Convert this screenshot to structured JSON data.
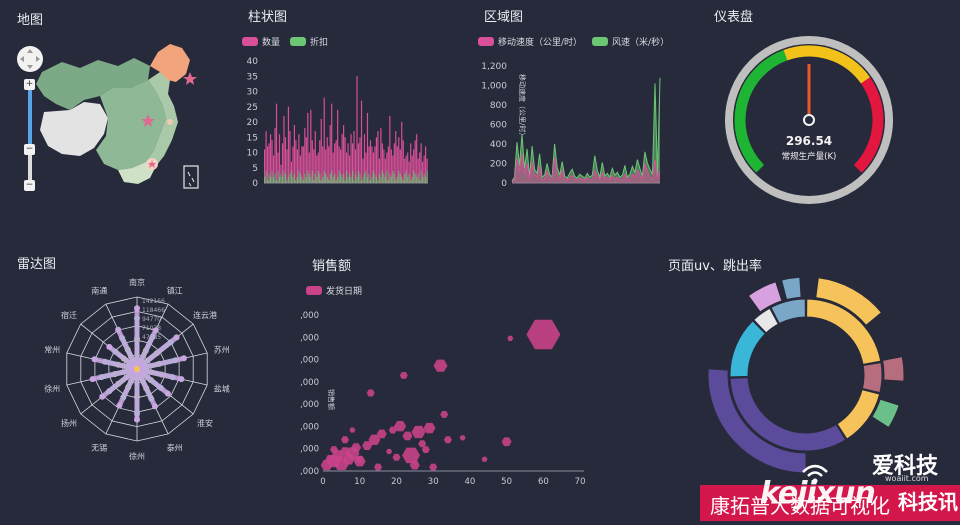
{
  "map": {
    "title": "地图",
    "zoom_in": "+",
    "zoom_out": "−",
    "slider_mid": "−"
  },
  "bar": {
    "title": "柱状图",
    "legend": [
      {
        "name": "数量",
        "color": "#d94f9a"
      },
      {
        "name": "折扣",
        "color": "#6cc775"
      }
    ],
    "yticks": [
      "40",
      "35",
      "30",
      "25",
      "20",
      "15",
      "10",
      "5",
      "0"
    ]
  },
  "area": {
    "title": "区域图",
    "legend": [
      {
        "name": "移动速度（公里/时）",
        "color": "#d94f9a"
      },
      {
        "name": "风速（米/秒）",
        "color": "#6cc775"
      }
    ],
    "yticks": [
      "1,200",
      "1,000",
      "800",
      "600",
      "400",
      "200",
      "0"
    ],
    "ylabel": "移动速度（公里/时）"
  },
  "gauge": {
    "title": "仪表盘",
    "value": "296.54",
    "label": "常规生产量(K)"
  },
  "radar": {
    "title": "雷达图",
    "axes": [
      "南京",
      "镇江",
      "连云港",
      "苏州",
      "盐城",
      "淮安",
      "泰州",
      "徐州",
      "无锡",
      "扬州",
      "徐州",
      "常州",
      "宿迁",
      "南通"
    ],
    "values": [
      "142166",
      "118466",
      "94770",
      "71078",
      "47385"
    ]
  },
  "scatter": {
    "title": "销售额",
    "legend": [
      {
        "name": "发货日期",
        "color": "#c9438a"
      }
    ],
    "yticks": [
      ",000",
      ",000",
      ",000",
      ",000",
      ",000",
      ",000",
      ",000",
      ",000"
    ],
    "xticks": [
      "0",
      "10",
      "20",
      "30",
      "40",
      "50",
      "60",
      "70"
    ],
    "ylabel": "销售额"
  },
  "sunburst": {
    "title": "页面uv、跳出率"
  },
  "watermark": {
    "brand": "爱科技",
    "domain": "woaiit.com",
    "big": "kejixun",
    "big_cn": "科技讯",
    "banner": "康拓普大数据可视化"
  },
  "chart_data": [
    {
      "type": "bar",
      "title": "柱状图",
      "ylim": [
        0,
        40
      ],
      "series": [
        {
          "name": "数量",
          "values": [
            11,
            17,
            12,
            13,
            16,
            14,
            9,
            18,
            26,
            10,
            16,
            6,
            13,
            22,
            15,
            11,
            25,
            17,
            7,
            12,
            19,
            14,
            11,
            16,
            9,
            12,
            12,
            18,
            15,
            23,
            10,
            24,
            14,
            11,
            17,
            9,
            10,
            14,
            21,
            12,
            28,
            11,
            15,
            12,
            19,
            26,
            10,
            13,
            14,
            24,
            12,
            11,
            16,
            19,
            15,
            10,
            13,
            9,
            16,
            13,
            17,
            11,
            35,
            13,
            15,
            27,
            8,
            16,
            10,
            23,
            12,
            14,
            12,
            10,
            12,
            15,
            17,
            8,
            18,
            13,
            11,
            8,
            10,
            12,
            22,
            11,
            9,
            13,
            17,
            12,
            15,
            11,
            20,
            14,
            8,
            9,
            10,
            7,
            13,
            9,
            11,
            14,
            16,
            8,
            10,
            13,
            7,
            9,
            12,
            8
          ]
        },
        {
          "name": "折扣",
          "values": [
            2,
            4,
            1,
            3,
            2,
            4,
            2,
            3,
            1,
            4,
            2,
            3,
            2,
            4,
            3,
            1,
            2,
            3,
            4,
            2,
            3,
            1,
            2,
            4,
            3,
            2,
            1,
            3,
            2,
            4,
            3,
            2,
            4,
            1,
            3,
            2,
            4,
            3,
            1,
            2,
            4,
            3,
            2,
            1,
            3,
            4,
            2,
            3,
            1,
            2,
            4,
            3,
            2,
            3,
            1,
            4,
            2,
            3,
            2,
            4,
            1,
            3,
            2,
            4,
            3,
            1,
            2,
            3,
            4,
            2,
            3,
            1,
            2,
            4,
            3,
            2,
            1,
            3,
            2,
            4,
            3,
            2,
            4,
            1,
            3,
            2,
            4,
            3,
            1,
            2,
            4,
            3,
            2,
            1,
            3,
            4,
            2,
            3,
            1,
            2,
            4,
            3,
            2,
            3,
            1,
            4,
            2,
            3,
            2,
            4
          ]
        }
      ]
    },
    {
      "type": "area",
      "title": "区域图",
      "ylim": [
        0,
        1200
      ],
      "series": [
        {
          "name": "移动速度（公里/时）",
          "values": [
            10,
            30,
            250,
            120,
            300,
            90,
            200,
            40,
            220,
            80,
            60,
            180,
            30,
            40,
            120,
            50,
            30,
            260,
            90,
            40,
            130,
            40,
            30,
            60,
            80,
            40,
            30,
            50,
            40,
            30,
            60,
            30,
            40,
            130,
            70,
            30,
            110,
            40,
            60,
            30,
            80,
            40,
            60,
            30,
            40,
            90,
            30,
            50,
            90,
            60,
            130,
            80,
            40,
            200,
            120,
            60,
            40,
            240,
            50,
            120
          ]
        },
        {
          "name": "风速（米/秒）",
          "values": [
            20,
            60,
            420,
            180,
            500,
            150,
            350,
            60,
            380,
            140,
            100,
            300,
            60,
            80,
            200,
            90,
            60,
            400,
            160,
            80,
            220,
            70,
            50,
            100,
            140,
            70,
            50,
            90,
            70,
            50,
            100,
            60,
            80,
            280,
            130,
            60,
            210,
            70,
            100,
            60,
            150,
            80,
            110,
            60,
            80,
            180,
            60,
            90,
            170,
            110,
            240,
            150,
            70,
            320,
            200,
            140,
            90,
            1020,
            80,
            1080
          ]
        }
      ]
    },
    {
      "type": "gauge",
      "value": 296.54,
      "label": "常规生产量(K)"
    },
    {
      "type": "radar",
      "title": "雷达图",
      "categories": [
        "南京",
        "镇江",
        "连云港",
        "苏州",
        "盐城",
        "淮安",
        "泰州",
        "徐州",
        "无锡",
        "扬州",
        "徐州",
        "常州",
        "宿迁",
        "南通"
      ],
      "rmax": 142166,
      "series": [
        {
          "color": "#d6d94a",
          "values": [
            60000,
            40000,
            50000,
            45000,
            50000,
            35000,
            42000,
            55000,
            40000,
            47000,
            45000,
            38000,
            33000,
            42000
          ]
        },
        {
          "color": "#7fcfbf",
          "values": [
            100000,
            70000,
            85000,
            78000,
            72000,
            60000,
            65000,
            88000,
            62000,
            70000,
            72000,
            65000,
            55000,
            68000
          ]
        },
        {
          "color": "#c8a6e0",
          "values": [
            120000,
            85000,
            100000,
            95000,
            90000,
            78000,
            82000,
            100000,
            80000,
            88000,
            90000,
            86000,
            70000,
            86000
          ]
        }
      ]
    },
    {
      "type": "scatter",
      "title": "销售额",
      "xlim": [
        0,
        70
      ],
      "ylim": [
        0,
        8
      ],
      "series": [
        {
          "name": "发货日期",
          "points": [
            [
              1,
              0.3,
              6
            ],
            [
              2,
              0.6,
              5
            ],
            [
              3,
              0.5,
              7
            ],
            [
              4,
              0.8,
              6
            ],
            [
              5,
              0.4,
              8
            ],
            [
              6,
              1.0,
              5
            ],
            [
              7,
              0.6,
              6
            ],
            [
              8,
              0.9,
              7
            ],
            [
              9,
              1.2,
              5
            ],
            [
              10,
              0.5,
              6
            ],
            [
              3,
              1.1,
              4
            ],
            [
              6,
              1.6,
              4
            ],
            [
              12,
              1.3,
              5
            ],
            [
              14,
              1.6,
              6
            ],
            [
              16,
              1.9,
              5
            ],
            [
              19,
              2.1,
              4
            ],
            [
              21,
              2.3,
              6
            ],
            [
              23,
              1.8,
              5
            ],
            [
              26,
              2.0,
              7
            ],
            [
              29,
              2.2,
              6
            ],
            [
              24,
              0.8,
              9
            ],
            [
              27,
              1.4,
              4
            ],
            [
              33,
              2.9,
              4
            ],
            [
              34,
              1.6,
              4
            ],
            [
              38,
              1.7,
              3
            ],
            [
              44,
              0.6,
              3
            ],
            [
              50,
              1.5,
              5
            ],
            [
              51,
              6.8,
              3
            ],
            [
              60,
              7.0,
              17
            ],
            [
              32,
              5.4,
              7
            ],
            [
              22,
              4.9,
              4
            ],
            [
              13,
              4.0,
              4
            ],
            [
              8,
              2.1,
              3
            ],
            [
              10,
              0.6,
              4
            ],
            [
              15,
              0.2,
              4
            ],
            [
              18,
              1.0,
              3
            ],
            [
              20,
              0.7,
              4
            ],
            [
              25,
              0.3,
              5
            ],
            [
              28,
              1.1,
              4
            ],
            [
              30,
              0.2,
              4
            ]
          ]
        }
      ]
    },
    {
      "type": "sunburst",
      "title": "页面uv、跳出率",
      "inner": [
        {
          "value": 40,
          "color": "#f5c35a"
        },
        {
          "value": 12,
          "color": "#b66d7d"
        },
        {
          "value": 22,
          "color": "#f5c35a"
        },
        {
          "value": 60,
          "color": "#5b4b9a"
        },
        {
          "value": 24,
          "color": "#3ab6d8"
        },
        {
          "value": 8,
          "color": "#e8e8e8"
        },
        {
          "value": 14,
          "color": "#7aa7c7"
        }
      ],
      "outer": [
        {
          "start": 0.02,
          "end": 0.14,
          "color": "#f5c35a"
        },
        {
          "start": 0.22,
          "end": 0.26,
          "color": "#b66d7d"
        },
        {
          "start": 0.3,
          "end": 0.34,
          "color": "#6bc08a"
        },
        {
          "start": 0.5,
          "end": 0.76,
          "color": "#5b4b9a"
        },
        {
          "start": 0.9,
          "end": 0.95,
          "color": "#d7a1e0"
        },
        {
          "start": 0.96,
          "end": 0.99,
          "color": "#7aa7c7"
        }
      ]
    }
  ]
}
